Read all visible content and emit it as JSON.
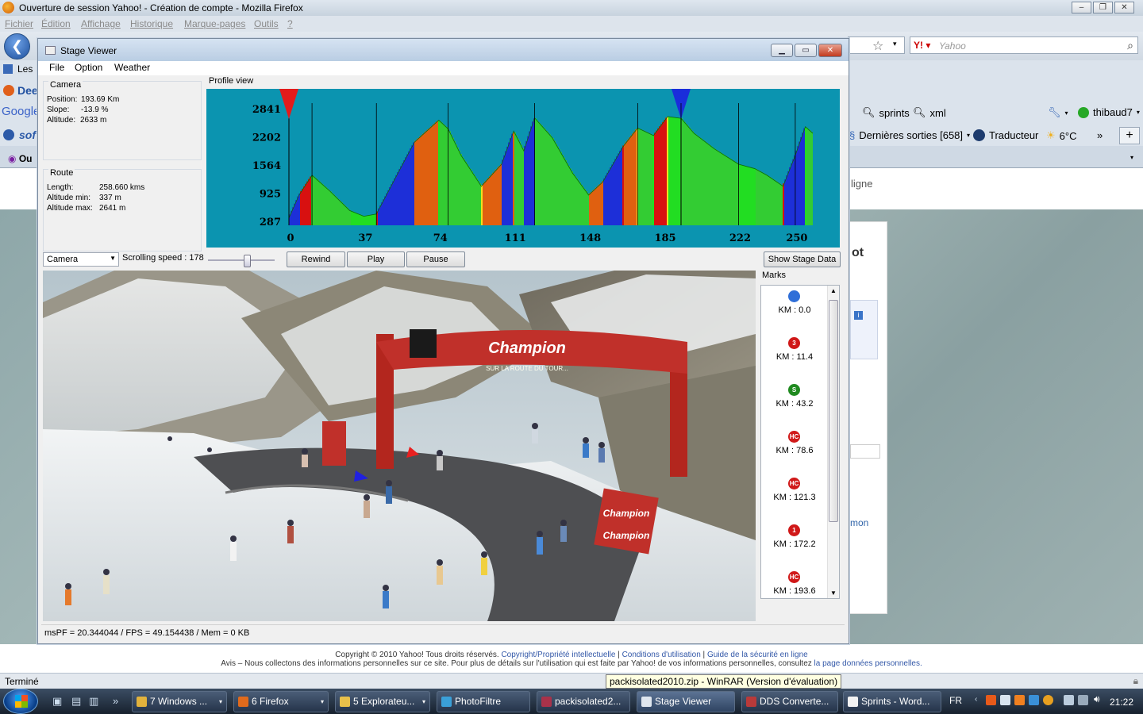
{
  "browser": {
    "title": "Ouverture de session Yahoo! - Création de compte - Mozilla Firefox",
    "menu": [
      "Fichier",
      "Édition",
      "Affichage",
      "Historique",
      "Marque-pages",
      "Outils",
      "?"
    ],
    "search_placeholder": "Yahoo",
    "bookmarks_row2": {
      "sprints": "sprints",
      "xml": "xml",
      "user": "thibaud7"
    },
    "bookmarks_row3": {
      "releases": "Dernières sorties [658]",
      "translator": "Traducteur",
      "weather": "6°C"
    },
    "left_fragments": {
      "les": "Les",
      "dee": "Dee",
      "google": "Google",
      "sof": "sof",
      "ou": "Ou"
    },
    "page_fragment": "ligne",
    "right_card": {
      "heading_fragment": "ot",
      "link_fragment": "mon"
    },
    "footer": {
      "line1_text": "Copyright © 2010 Yahoo! Tous droits réservés.",
      "line1_links": [
        "Copyright/Propriété intellectuelle",
        "Conditions d'utilisation",
        "Guide de la sécurité en ligne"
      ],
      "line2_text": "Avis – Nous collectons des informations personnelles sur ce site. Pour plus de détails sur l'utilisation qui est faite par Yahoo! de vos informations personnelles, consultez",
      "line2_link": "la page données personnelles."
    },
    "status": "Terminé",
    "tooltip": "packisolated2010.zip - WinRAR (Version d'évaluation)"
  },
  "taskbar": {
    "buttons": [
      {
        "label": "7 Windows ...",
        "color": "#e2b23c"
      },
      {
        "label": "6 Firefox",
        "color": "#e06a1c"
      },
      {
        "label": "5 Explorateu...",
        "color": "#e8c04a"
      },
      {
        "label": "PhotoFiltre",
        "color": "#3aa0d8"
      },
      {
        "label": "packisolated2...",
        "color": "#a8324a"
      },
      {
        "label": "Stage Viewer",
        "color": "#dfe6ee"
      },
      {
        "label": "DDS Converte...",
        "color": "#b93a3a"
      },
      {
        "label": "Sprints - Word...",
        "color": "#f2f2f2"
      }
    ],
    "lang": "FR",
    "clock": "21:22"
  },
  "stage_viewer": {
    "title": "Stage Viewer",
    "menu": [
      "File",
      "Option",
      "Weather"
    ],
    "camera": {
      "heading": "Camera",
      "position_label": "Position:",
      "position": "193.69 Km",
      "slope_label": "Slope:",
      "slope": "-13.9 %",
      "altitude_label": "Altitude:",
      "altitude": "2633 m"
    },
    "route": {
      "heading": "Route",
      "length_label": "Length:",
      "length": "258.660 kms",
      "min_label": "Altitude min:",
      "min": "337 m",
      "max_label": "Altitude max:",
      "max": "2641 m"
    },
    "profile_heading": "Profile view",
    "controls": {
      "camera_select": "Camera",
      "speed_label": "Scrolling speed :",
      "speed": "178",
      "speed_fraction": 0.6,
      "rewind": "Rewind",
      "play": "Play",
      "pause": "Pause",
      "show_stage": "Show Stage Data"
    },
    "marks_heading": "Marks",
    "marks": [
      {
        "symbol": "",
        "color": "#2f6fd8",
        "km": "KM : 0.0"
      },
      {
        "symbol": "3",
        "color": "#d01818",
        "km": "KM : 11.4"
      },
      {
        "symbol": "S",
        "color": "#1f8a1f",
        "km": "KM : 43.2"
      },
      {
        "symbol": "HC",
        "color": "#d01818",
        "km": "KM : 78.6"
      },
      {
        "symbol": "HC",
        "color": "#d01818",
        "km": "KM : 121.3"
      },
      {
        "symbol": "1",
        "color": "#d01818",
        "km": "KM : 172.2"
      },
      {
        "symbol": "HC",
        "color": "#d01818",
        "km": "KM : 193.6"
      }
    ],
    "status": "msPF = 20.344044 / FPS = 49.154438 / Mem = 0 KB",
    "banner": {
      "brand": "Champion",
      "subtitle": "SUR LA ROUTE DU TOUR..."
    }
  },
  "chart_data": {
    "type": "area",
    "title": "",
    "x_ticks": [
      0,
      37,
      74,
      111,
      148,
      185,
      222,
      250
    ],
    "y_ticks": [
      287,
      925,
      1564,
      2202,
      2841
    ],
    "xlim": [
      0,
      258.66
    ],
    "ylim": [
      287,
      2841
    ],
    "background": "#0b94b0",
    "series": [
      {
        "x": [
          0,
          5,
          11.4,
          20,
          30,
          37,
          43.2,
          55,
          62,
          74,
          78.6,
          85,
          95,
          105,
          111,
          116,
          121.3,
          130,
          140,
          148,
          155,
          165,
          172.2,
          180,
          187,
          193.6,
          200,
          210,
          222,
          230,
          236,
          244,
          250,
          255,
          258.66
        ],
        "y": [
          380,
          900,
          1350,
          1000,
          550,
          420,
          470,
          1500,
          2100,
          2600,
          2400,
          1800,
          1100,
          1600,
          2350,
          1900,
          2650,
          2200,
          1400,
          900,
          1200,
          2000,
          2420,
          2250,
          2680,
          2641,
          2300,
          1950,
          1600,
          1500,
          1350,
          1100,
          1800,
          2450,
          2300
        ]
      }
    ],
    "markers": [
      {
        "km": 0,
        "color": "#e31b1b"
      },
      {
        "km": 193.6,
        "color": "#1a2ddb"
      }
    ]
  }
}
